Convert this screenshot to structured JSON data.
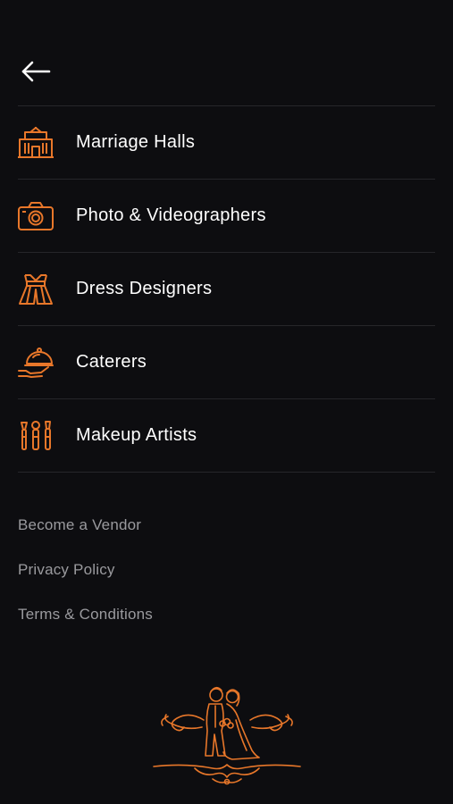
{
  "header": {
    "back_icon": "arrow-left-icon"
  },
  "menu": {
    "items": [
      {
        "label": "Marriage Halls",
        "icon": "marriage-hall-icon"
      },
      {
        "label": "Photo & Videographers",
        "icon": "camera-icon"
      },
      {
        "label": "Dress Designers",
        "icon": "dress-icon"
      },
      {
        "label": "Caterers",
        "icon": "catering-cloche-icon"
      },
      {
        "label": "Makeup Artists",
        "icon": "makeup-brushes-icon"
      }
    ]
  },
  "links": {
    "become_vendor": "Become a Vendor",
    "privacy_policy": "Privacy Policy",
    "terms": "Terms & Conditions"
  },
  "colors": {
    "background": "#0d0d10",
    "accent": "#e8772a",
    "text": "#ffffff",
    "muted_text": "#9a9a9e",
    "divider": "#26262a"
  },
  "logo": {
    "icon": "wedding-couple-logo"
  }
}
